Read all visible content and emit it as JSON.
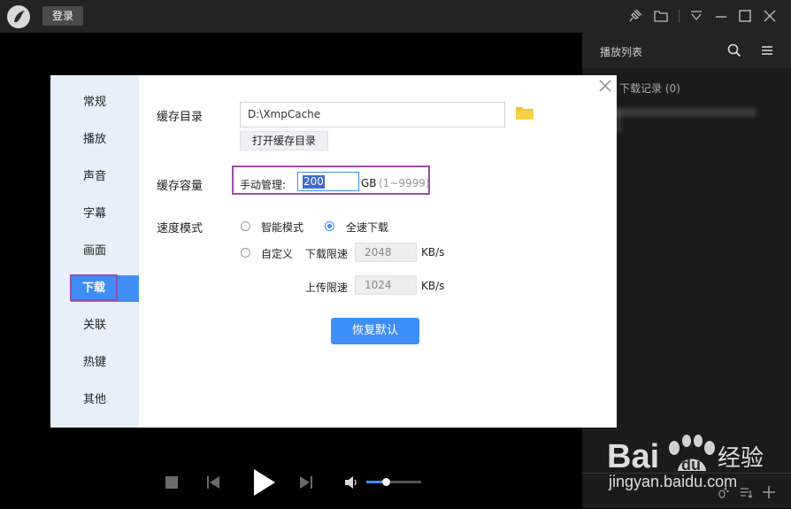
{
  "topbar": {
    "login_label": "登录"
  },
  "playlist": {
    "title": "播放列表",
    "download_record": "下载记录 (0)"
  },
  "settings": {
    "nav": [
      "常规",
      "播放",
      "声音",
      "字幕",
      "画面",
      "下载",
      "关联",
      "热键",
      "其他"
    ],
    "active_nav": "下载",
    "cache_dir": {
      "label": "缓存目录",
      "value": "D:\\XmpCache",
      "open_button": "打开缓存目录"
    },
    "cache_capacity": {
      "label": "缓存容量",
      "manual_label": "手动管理:",
      "value": "200",
      "unit": "GB",
      "range": "(1~9999)"
    },
    "speed_mode": {
      "label": "速度模式",
      "options": [
        "智能模式",
        "全速下载",
        "自定义"
      ],
      "selected": "全速下载",
      "download_limit_label": "下载限速",
      "download_limit": "2048",
      "upload_limit_label": "上传限速",
      "upload_limit": "1024",
      "unit": "KB/s"
    },
    "restore_button": "恢复默认"
  },
  "player": {
    "volume_level": 0.35
  },
  "watermark": {
    "brand": "Bai du 经验",
    "url": "jingyan.baidu.com"
  },
  "colors": {
    "accent": "#3f8ef8",
    "highlight": "#9c4ca5",
    "nav_bg": "#e6effa",
    "folder": "#f6c531"
  }
}
